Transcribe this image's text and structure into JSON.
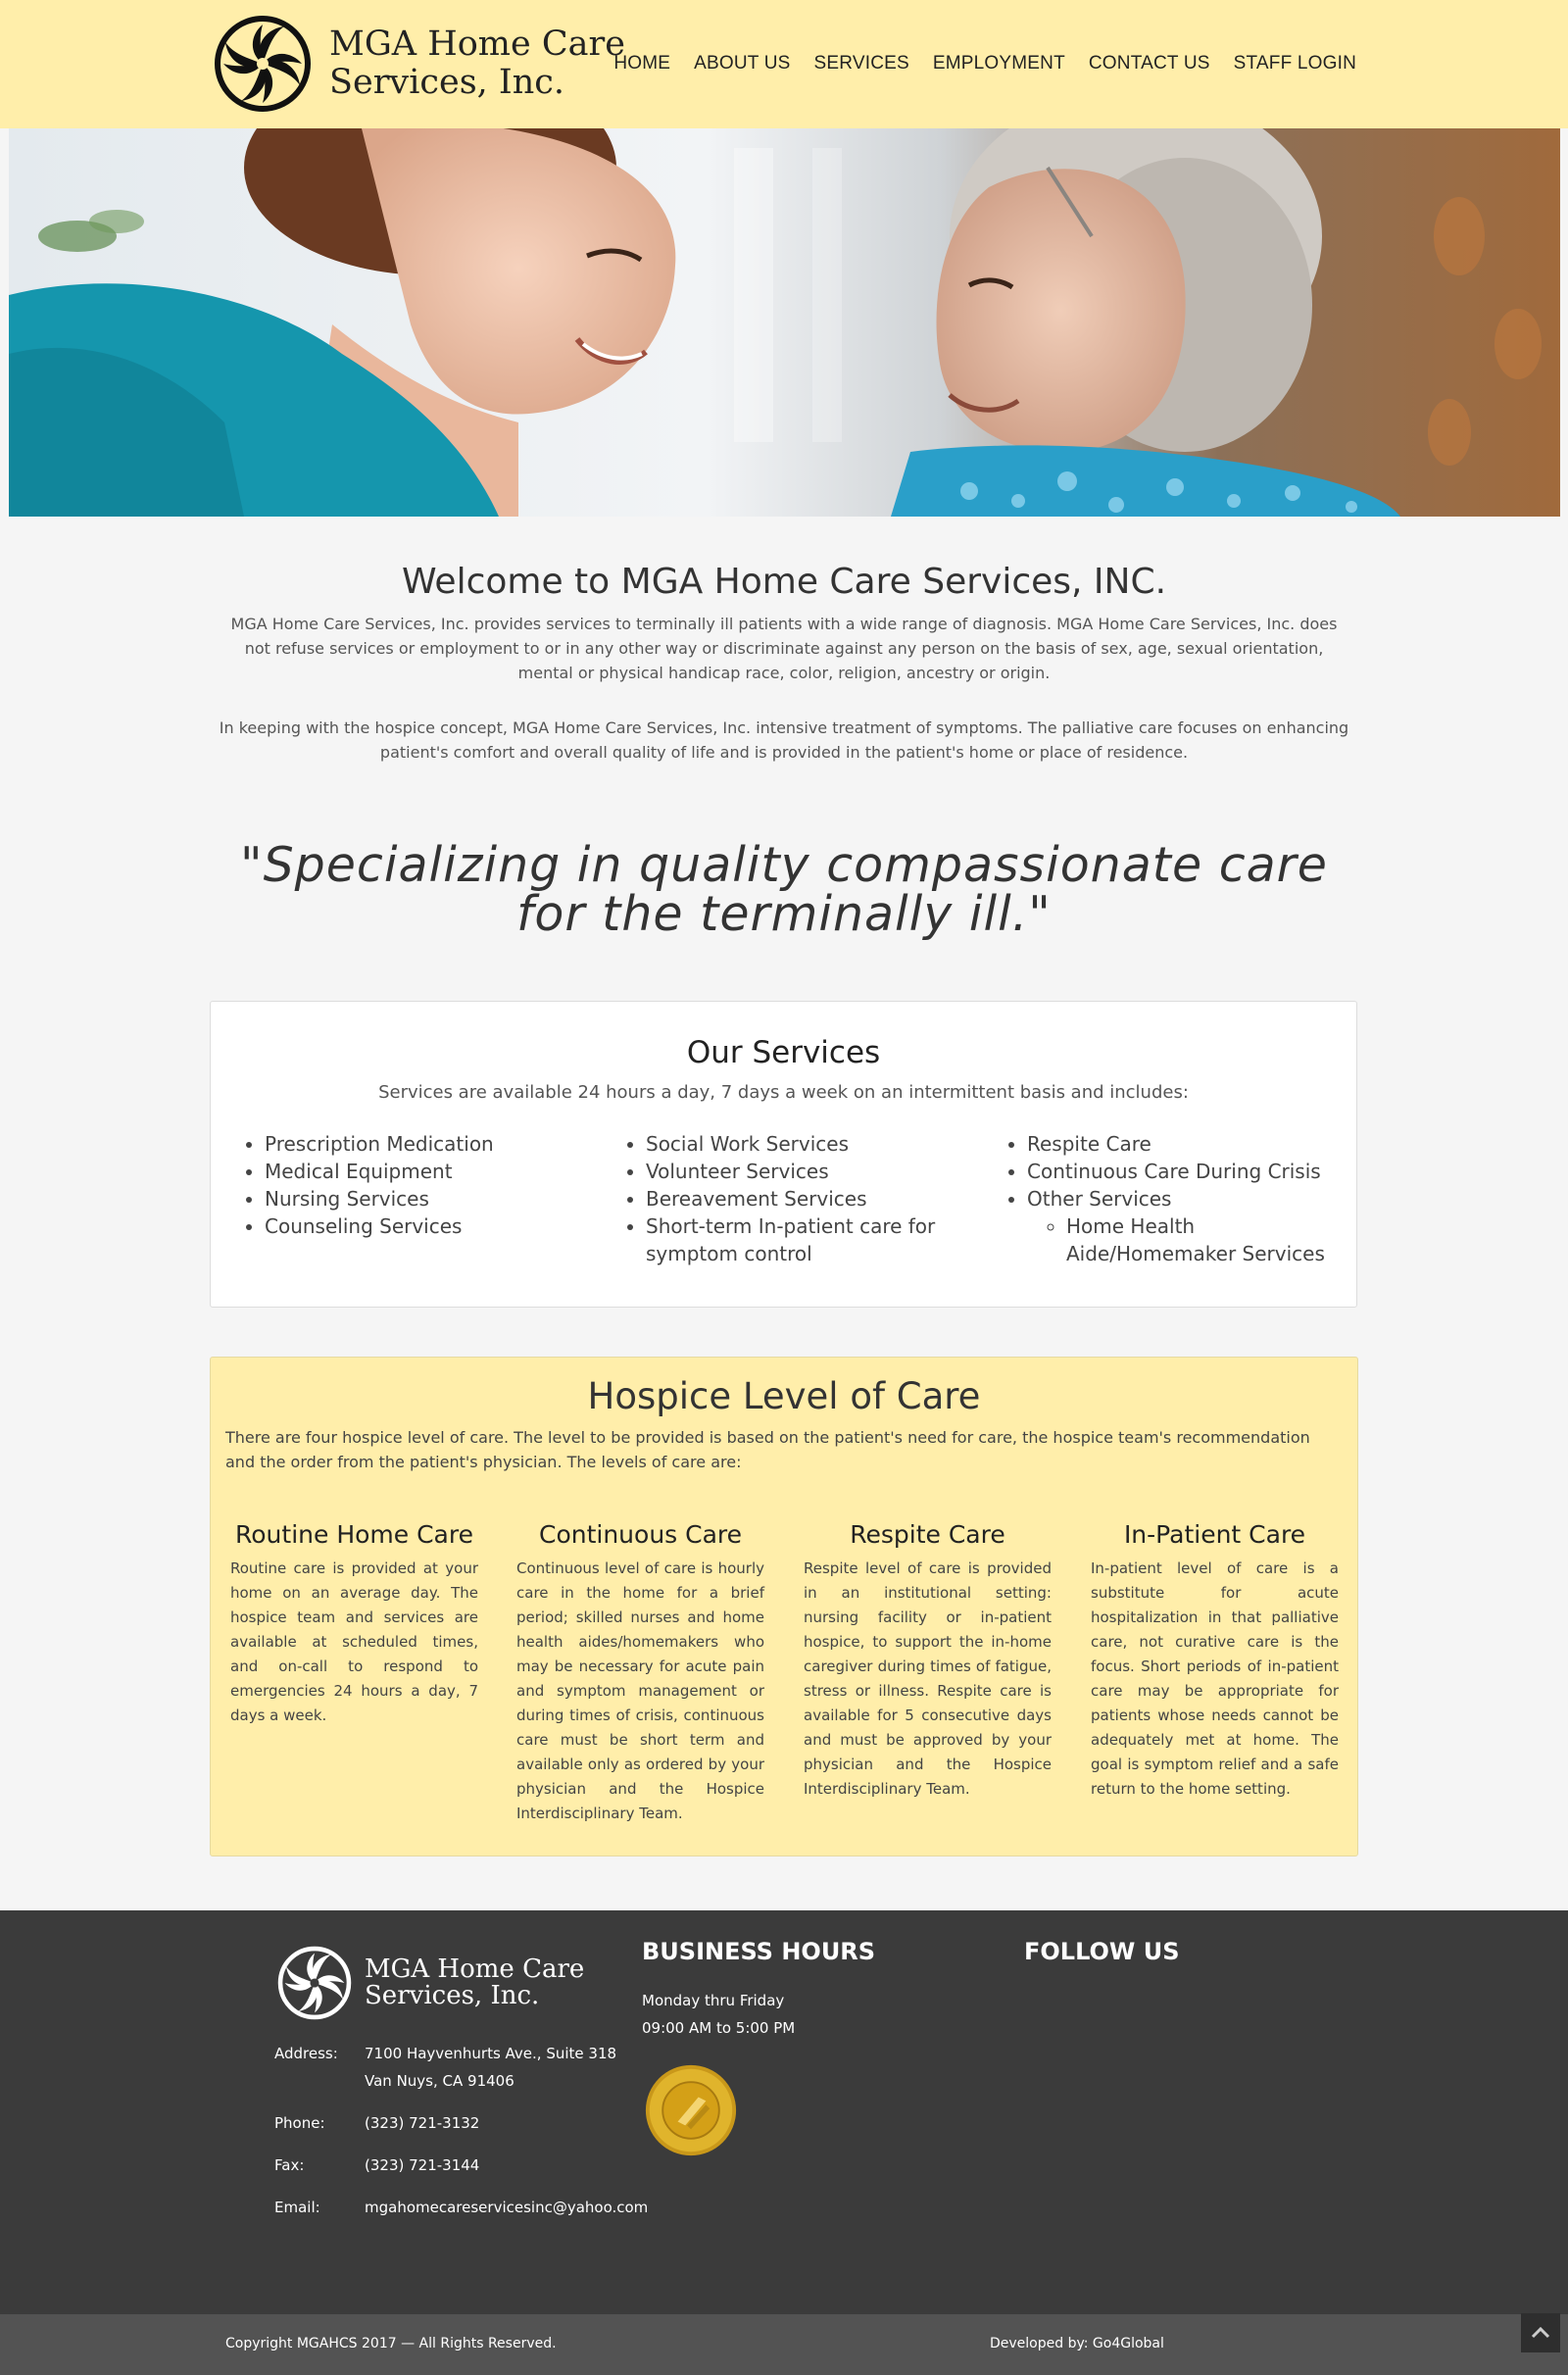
{
  "header": {
    "logo_line1": "MGA Home Care",
    "logo_line2": "Services, Inc.",
    "nav": [
      "HOME",
      "ABOUT US",
      "SERVICES",
      "EMPLOYMENT",
      "CONTACT US",
      "STAFF LOGIN"
    ]
  },
  "hero": {
    "description_icon": "caregiver-with-elderly-woman-photo"
  },
  "welcome": {
    "title": "Welcome to MGA Home Care Services, INC.",
    "p1": "MGA Home Care Services, Inc. provides services to terminally ill patients with a wide range of diagnosis. MGA Home Care Services, Inc. does not refuse services or employment to or in any other way or discriminate against any person on the basis of sex, age, sexual orientation, mental or physical handicap race, color, religion, ancestry or origin.",
    "p2": "In keeping with the hospice concept, MGA Home Care Services, Inc. intensive treatment of symptoms. The palliative care focuses on enhancing patient's comfort and overall quality of life and is provided in the patient's home or place of residence.",
    "quote": "\"Specializing in quality compassionate care for the terminally ill.\""
  },
  "services": {
    "title": "Our Services",
    "intro": "Services are available 24 hours a day, 7 days a week on an intermittent basis and includes:",
    "col1": [
      "Prescription Medication",
      "Medical Equipment",
      "Nursing Services",
      "Counseling Services"
    ],
    "col2": [
      "Social Work Services",
      "Volunteer Services",
      "Bereavement Services",
      "Short-term In-patient care for symptom control"
    ],
    "col3": [
      "Respite Care",
      "Continuous Care During Crisis",
      "Other Services"
    ],
    "col3_sub": [
      "Home Health Aide/Homemaker Services"
    ]
  },
  "hospice": {
    "title": "Hospice Level of Care",
    "intro": "There are four hospice level of care. The level to be provided is based on the patient's need for care, the hospice team's recommendation and the order from the patient's physician. The levels of care are:",
    "levels": [
      {
        "title": "Routine Home Care",
        "text": "Routine care is provided at your home on an average day. The hospice team and services are available at scheduled times, and on-call to respond to emergencies 24 hours a day, 7 days a week."
      },
      {
        "title": "Continuous Care",
        "text": "Continuous level of care is hourly care in the home for a brief period; skilled nurses and home health aides/homemakers who may be necessary for acute pain and symptom management or during times of crisis, continuous care must be short term and available only as ordered by your physician and the Hospice Interdisciplinary Team."
      },
      {
        "title": "Respite Care",
        "text": "Respite level of care is provided in an institutional setting: nursing facility or in-patient hospice, to support the in-home caregiver during times of fatigue, stress or illness. Respite care is available for 5 consecutive days and must be approved by your physician and the Hospice Interdisciplinary Team."
      },
      {
        "title": "In-Patient Care",
        "text": "In-patient level of care is a substitute for acute hospitalization in that palliative care, not curative care is the focus. Short periods of in-patient care may be appropriate for patients whose needs cannot be adequately met at home. The goal is symptom relief and a safe return to the home setting."
      }
    ]
  },
  "footer": {
    "logo_line1": "MGA Home Care",
    "logo_line2": "Services, Inc.",
    "address_label": "Address:",
    "address": "7100 Hayvenhurts Ave., Suite 318 Van Nuys, CA 91406",
    "phone_label": "Phone:",
    "phone": "(323) 721-3132",
    "fax_label": "Fax:",
    "fax": "(323) 721-3144",
    "email_label": "Email:",
    "email": "mgahomecareservicesinc@yahoo.com",
    "hours_title": "BUSINESS HOURS",
    "hours_days": "Monday thru Friday",
    "hours_time": "09:00 AM to 5:00 PM",
    "follow_title": "FOLLOW US",
    "copyright": "Copyright MGAHCS 2017 — All Rights Reserved.",
    "developed": "Developed by: Go4Global"
  },
  "colors": {
    "header_bg": "#ffeeaa",
    "footer_bg": "#3b3b3b",
    "bottom_bar": "#535353",
    "seal_gold": "#d4a017"
  }
}
